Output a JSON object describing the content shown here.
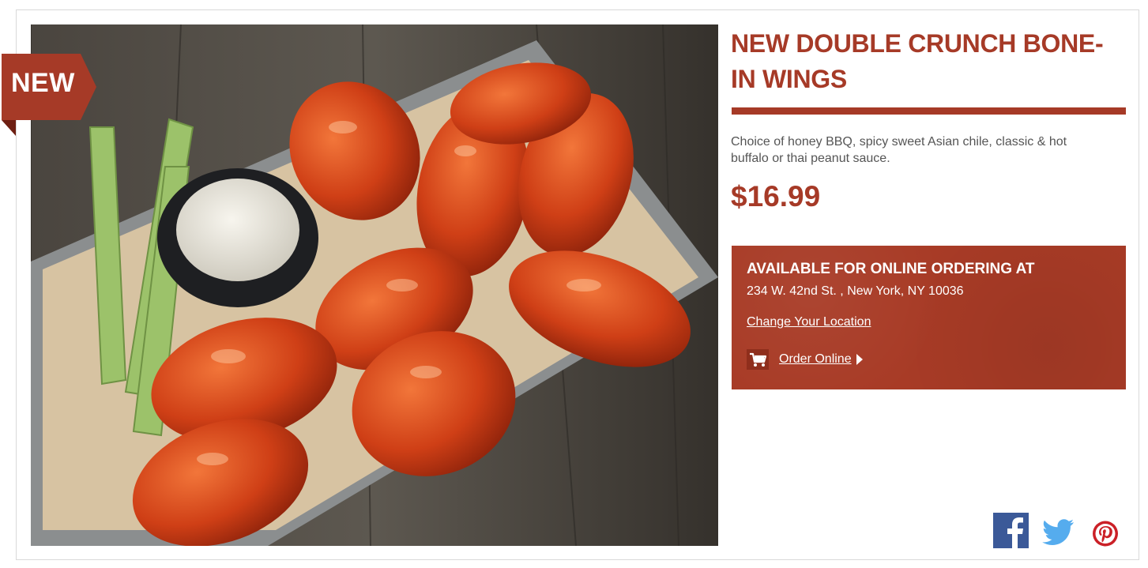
{
  "product": {
    "badge": "NEW",
    "title": "NEW DOUBLE CRUNCH BONE-IN WINGS",
    "description": "Choice of honey BBQ, spicy sweet Asian chile, classic & hot buffalo or thai peanut sauce.",
    "price": "$16.99",
    "image_icon": "wings-photo"
  },
  "ordering": {
    "heading": "AVAILABLE FOR ONLINE ORDERING AT",
    "address": "234 W. 42nd St. , New York, NY 10036",
    "change_location_label": "Change Your Location",
    "order_online_label": "Order Online",
    "cart_icon": "cart-icon",
    "caret_icon": "caret-right-icon"
  },
  "social": {
    "icons": [
      "facebook-icon",
      "twitter-icon",
      "pinterest-icon"
    ]
  },
  "colors": {
    "brand_red": "#a63a27",
    "order_box": "#a83b26",
    "facebook": "#3b5998",
    "twitter": "#55acee",
    "pinterest": "#cb2027"
  }
}
